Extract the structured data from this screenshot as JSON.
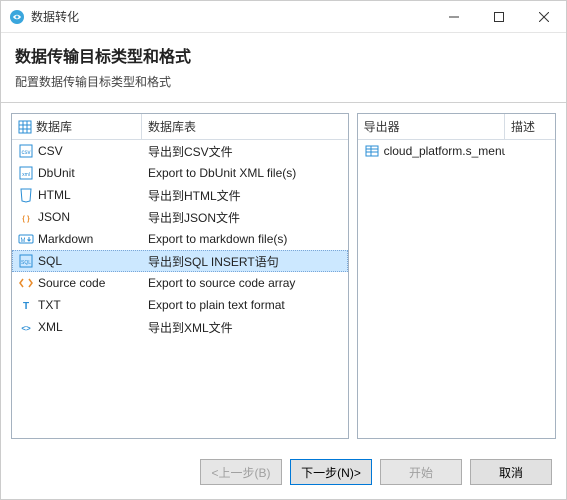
{
  "window": {
    "title": "数据转化"
  },
  "header": {
    "heading": "数据传输目标类型和格式",
    "subtitle": "配置数据传输目标类型和格式"
  },
  "leftPanel": {
    "col1": "数据库",
    "col2": "数据库表",
    "items": [
      {
        "name": "CSV",
        "desc": "导出到CSV文件",
        "icon": "csv"
      },
      {
        "name": "DbUnit",
        "desc": "Export to DbUnit XML file(s)",
        "icon": "dbunit"
      },
      {
        "name": "HTML",
        "desc": "导出到HTML文件",
        "icon": "html"
      },
      {
        "name": "JSON",
        "desc": "导出到JSON文件",
        "icon": "json"
      },
      {
        "name": "Markdown",
        "desc": "Export to markdown file(s)",
        "icon": "markdown"
      },
      {
        "name": "SQL",
        "desc": "导出到SQL INSERT语句",
        "icon": "sql",
        "selected": true
      },
      {
        "name": "Source code",
        "desc": "Export to source code array",
        "icon": "code"
      },
      {
        "name": "TXT",
        "desc": "Export to plain text format",
        "icon": "txt"
      },
      {
        "name": "XML",
        "desc": "导出到XML文件",
        "icon": "xml"
      }
    ]
  },
  "rightPanel": {
    "col1": "导出器",
    "col2": "描述",
    "items": [
      {
        "name": "cloud_platform.s_menu",
        "desc": "",
        "icon": "table"
      }
    ]
  },
  "footer": {
    "back": "<上一步(B)",
    "next": "下一步(N)>",
    "start": "开始",
    "cancel": "取消"
  },
  "colors": {
    "accent": "#0078d7",
    "selection": "#cce8ff"
  }
}
